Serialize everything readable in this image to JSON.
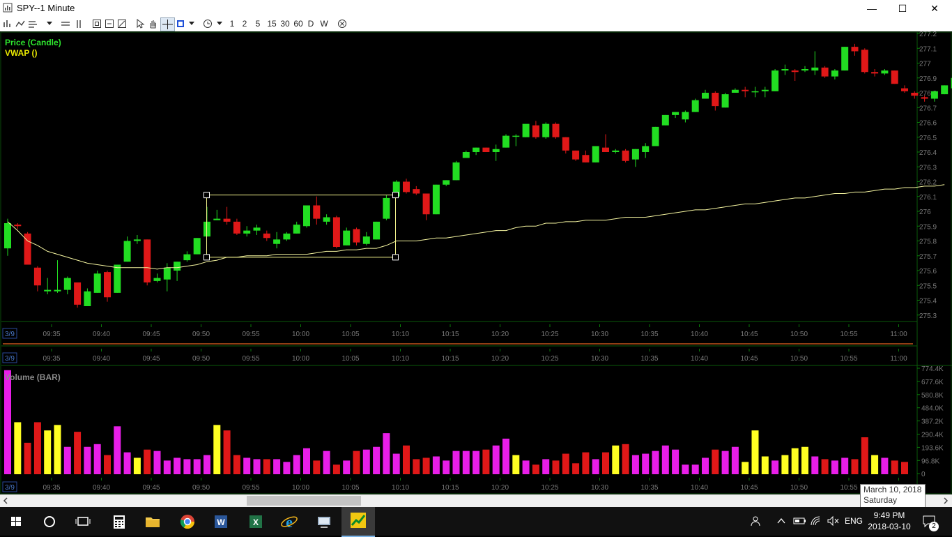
{
  "window": {
    "title": "SPY--1 Minute",
    "min_label": "—",
    "max_label": "☐",
    "close_label": "✕"
  },
  "toolbar": {
    "periods": [
      "1",
      "2",
      "5",
      "15",
      "30",
      "60",
      "D",
      "W"
    ]
  },
  "legend": {
    "price": "Price (Candle)",
    "vwap": "VWAP ()",
    "volume": "Volume (BAR)"
  },
  "tooltip": {
    "line1": "March 10, 2018",
    "line2": "Saturday"
  },
  "taskbar": {
    "time": "9:49 PM",
    "date": "2018-03-10",
    "lang": "ENG",
    "notifications": "2"
  },
  "chart_data": {
    "type": "candlestick",
    "date_label": "3/9",
    "x_ticks": [
      "09:35",
      "09:40",
      "09:45",
      "09:50",
      "09:55",
      "10:00",
      "10:05",
      "10:10",
      "10:15",
      "10:20",
      "10:25",
      "10:30",
      "10:35",
      "10:40",
      "10:45",
      "10:50",
      "10:55",
      "11:00"
    ],
    "price_ticks": [
      277.2,
      277.1,
      277,
      276.9,
      276.8,
      276.7,
      276.6,
      276.5,
      276.4,
      276.3,
      276.2,
      276.1,
      276,
      275.9,
      275.8,
      275.7,
      275.6,
      275.5,
      275.4,
      275.3
    ],
    "price_tick_labels": [
      "277.2",
      "277.1",
      "277",
      "276.9",
      "276.8",
      "276.7",
      "276.6",
      "276.5",
      "276.4",
      "276.3",
      "276.2",
      "276.1",
      "276",
      "275.9",
      "275.8",
      "275.7",
      "275.6",
      "275.5",
      "275.4",
      "275.3"
    ],
    "ylim": [
      275.28,
      277.2
    ],
    "volume_ticks": [
      "774.4K",
      "677.6K",
      "580.8K",
      "484.0K",
      "387.2K",
      "290.4K",
      "193.6K",
      "96.8K",
      "0"
    ],
    "volume_ylim": [
      0,
      774400
    ],
    "colors": {
      "up": "#22dd22",
      "down": "#e01818",
      "vwap": "#f5f5a0",
      "vol_up": "#e81ee8",
      "vol_down": "#e01818",
      "vol_flat": "#ffff22"
    },
    "candles": [
      {
        "o": 275.75,
        "h": 275.95,
        "l": 275.7,
        "c": 275.92
      },
      {
        "o": 275.91,
        "h": 275.92,
        "l": 275.88,
        "c": 275.9
      },
      {
        "o": 275.85,
        "h": 275.86,
        "l": 275.64,
        "c": 275.64
      },
      {
        "o": 275.62,
        "h": 275.63,
        "l": 275.46,
        "c": 275.5
      },
      {
        "o": 275.46,
        "h": 275.55,
        "l": 275.44,
        "c": 275.47
      },
      {
        "o": 275.46,
        "h": 275.67,
        "l": 275.45,
        "c": 275.47
      },
      {
        "o": 275.47,
        "h": 275.56,
        "l": 275.44,
        "c": 275.55
      },
      {
        "o": 275.52,
        "h": 275.52,
        "l": 275.35,
        "c": 275.37
      },
      {
        "o": 275.36,
        "h": 275.48,
        "l": 275.36,
        "c": 275.46
      },
      {
        "o": 275.45,
        "h": 275.6,
        "l": 275.45,
        "c": 275.58
      },
      {
        "o": 275.59,
        "h": 275.6,
        "l": 275.39,
        "c": 275.42
      },
      {
        "o": 275.45,
        "h": 275.64,
        "l": 275.45,
        "c": 275.64
      },
      {
        "o": 275.66,
        "h": 275.83,
        "l": 275.66,
        "c": 275.8
      },
      {
        "o": 275.8,
        "h": 275.84,
        "l": 275.78,
        "c": 275.81
      },
      {
        "o": 275.81,
        "h": 275.81,
        "l": 275.5,
        "c": 275.52
      },
      {
        "o": 275.53,
        "h": 275.58,
        "l": 275.52,
        "c": 275.55
      },
      {
        "o": 275.54,
        "h": 275.65,
        "l": 275.46,
        "c": 275.62
      },
      {
        "o": 275.6,
        "h": 275.66,
        "l": 275.53,
        "c": 275.66
      },
      {
        "o": 275.67,
        "h": 275.73,
        "l": 275.66,
        "c": 275.71
      },
      {
        "o": 275.71,
        "h": 275.82,
        "l": 275.71,
        "c": 275.82
      },
      {
        "o": 275.83,
        "h": 276.03,
        "l": 275.83,
        "c": 275.93
      },
      {
        "o": 275.94,
        "h": 276.01,
        "l": 275.94,
        "c": 275.95
      },
      {
        "o": 275.95,
        "h": 276.03,
        "l": 275.91,
        "c": 275.93
      },
      {
        "o": 275.93,
        "h": 275.95,
        "l": 275.84,
        "c": 275.85
      },
      {
        "o": 275.85,
        "h": 275.9,
        "l": 275.83,
        "c": 275.87
      },
      {
        "o": 275.87,
        "h": 275.91,
        "l": 275.84,
        "c": 275.89
      },
      {
        "o": 275.85,
        "h": 275.87,
        "l": 275.8,
        "c": 275.82
      },
      {
        "o": 275.78,
        "h": 275.86,
        "l": 275.75,
        "c": 275.81
      },
      {
        "o": 275.81,
        "h": 275.86,
        "l": 275.8,
        "c": 275.85
      },
      {
        "o": 275.85,
        "h": 275.93,
        "l": 275.85,
        "c": 275.91
      },
      {
        "o": 275.9,
        "h": 276.04,
        "l": 275.89,
        "c": 276.04
      },
      {
        "o": 276.04,
        "h": 276.1,
        "l": 275.91,
        "c": 275.95
      },
      {
        "o": 275.93,
        "h": 275.98,
        "l": 275.91,
        "c": 275.96
      },
      {
        "o": 275.96,
        "h": 275.97,
        "l": 275.75,
        "c": 275.76
      },
      {
        "o": 275.77,
        "h": 275.89,
        "l": 275.77,
        "c": 275.87
      },
      {
        "o": 275.88,
        "h": 275.89,
        "l": 275.77,
        "c": 275.79
      },
      {
        "o": 275.78,
        "h": 275.86,
        "l": 275.77,
        "c": 275.83
      },
      {
        "o": 275.81,
        "h": 275.93,
        "l": 275.81,
        "c": 275.93
      },
      {
        "o": 275.95,
        "h": 276.11,
        "l": 275.94,
        "c": 276.09
      },
      {
        "o": 276.1,
        "h": 276.21,
        "l": 276.09,
        "c": 276.2
      },
      {
        "o": 276.2,
        "h": 276.22,
        "l": 276.12,
        "c": 276.13
      },
      {
        "o": 276.15,
        "h": 276.17,
        "l": 276.11,
        "c": 276.12
      },
      {
        "o": 276.12,
        "h": 276.12,
        "l": 275.94,
        "c": 275.98
      },
      {
        "o": 275.98,
        "h": 276.18,
        "l": 275.98,
        "c": 276.18
      },
      {
        "o": 276.18,
        "h": 276.21,
        "l": 276.17,
        "c": 276.21
      },
      {
        "o": 276.21,
        "h": 276.34,
        "l": 276.21,
        "c": 276.33
      },
      {
        "o": 276.36,
        "h": 276.41,
        "l": 276.36,
        "c": 276.4
      },
      {
        "o": 276.4,
        "h": 276.43,
        "l": 276.38,
        "c": 276.43
      },
      {
        "o": 276.43,
        "h": 276.43,
        "l": 276.4,
        "c": 276.4
      },
      {
        "o": 276.4,
        "h": 276.45,
        "l": 276.34,
        "c": 276.42
      },
      {
        "o": 276.43,
        "h": 276.52,
        "l": 276.43,
        "c": 276.51
      },
      {
        "o": 276.51,
        "h": 276.52,
        "l": 276.44,
        "c": 276.51
      },
      {
        "o": 276.5,
        "h": 276.56,
        "l": 276.5,
        "c": 276.59
      },
      {
        "o": 276.58,
        "h": 276.61,
        "l": 276.49,
        "c": 276.5
      },
      {
        "o": 276.5,
        "h": 276.6,
        "l": 276.49,
        "c": 276.59
      },
      {
        "o": 276.59,
        "h": 276.6,
        "l": 276.49,
        "c": 276.5
      },
      {
        "o": 276.5,
        "h": 276.5,
        "l": 276.39,
        "c": 276.41
      },
      {
        "o": 276.41,
        "h": 276.41,
        "l": 276.34,
        "c": 276.35
      },
      {
        "o": 276.38,
        "h": 276.41,
        "l": 276.33,
        "c": 276.33
      },
      {
        "o": 276.33,
        "h": 276.44,
        "l": 276.33,
        "c": 276.44
      },
      {
        "o": 276.43,
        "h": 276.52,
        "l": 276.4,
        "c": 276.4
      },
      {
        "o": 276.4,
        "h": 276.42,
        "l": 276.39,
        "c": 276.41
      },
      {
        "o": 276.41,
        "h": 276.42,
        "l": 276.33,
        "c": 276.34
      },
      {
        "o": 276.35,
        "h": 276.42,
        "l": 276.3,
        "c": 276.42
      },
      {
        "o": 276.4,
        "h": 276.46,
        "l": 276.36,
        "c": 276.44
      },
      {
        "o": 276.44,
        "h": 276.57,
        "l": 276.44,
        "c": 276.57
      },
      {
        "o": 276.58,
        "h": 276.65,
        "l": 276.58,
        "c": 276.65
      },
      {
        "o": 276.65,
        "h": 276.67,
        "l": 276.63,
        "c": 276.67
      },
      {
        "o": 276.62,
        "h": 276.68,
        "l": 276.6,
        "c": 276.67
      },
      {
        "o": 276.67,
        "h": 276.76,
        "l": 276.67,
        "c": 276.75
      },
      {
        "o": 276.76,
        "h": 276.82,
        "l": 276.76,
        "c": 276.8
      },
      {
        "o": 276.8,
        "h": 276.81,
        "l": 276.68,
        "c": 276.71
      },
      {
        "o": 276.7,
        "h": 276.8,
        "l": 276.7,
        "c": 276.79
      },
      {
        "o": 276.8,
        "h": 276.83,
        "l": 276.8,
        "c": 276.82
      },
      {
        "o": 276.82,
        "h": 276.84,
        "l": 276.77,
        "c": 276.81
      },
      {
        "o": 276.81,
        "h": 276.84,
        "l": 276.77,
        "c": 276.81
      },
      {
        "o": 276.81,
        "h": 276.84,
        "l": 276.77,
        "c": 276.82
      },
      {
        "o": 276.81,
        "h": 276.96,
        "l": 276.81,
        "c": 276.95
      },
      {
        "o": 276.95,
        "h": 276.99,
        "l": 276.92,
        "c": 276.96
      },
      {
        "o": 276.95,
        "h": 276.96,
        "l": 276.88,
        "c": 276.94
      },
      {
        "o": 276.95,
        "h": 276.98,
        "l": 276.94,
        "c": 276.96
      },
      {
        "o": 276.95,
        "h": 277.08,
        "l": 276.92,
        "c": 276.97
      },
      {
        "o": 276.97,
        "h": 276.98,
        "l": 276.9,
        "c": 276.91
      },
      {
        "o": 276.91,
        "h": 276.96,
        "l": 276.89,
        "c": 276.95
      },
      {
        "o": 276.95,
        "h": 277.11,
        "l": 276.95,
        "c": 277.11
      },
      {
        "o": 277.11,
        "h": 277.13,
        "l": 277.05,
        "c": 277.08
      },
      {
        "o": 277.09,
        "h": 277.1,
        "l": 276.93,
        "c": 276.94
      },
      {
        "o": 276.94,
        "h": 276.96,
        "l": 276.91,
        "c": 276.93
      },
      {
        "o": 276.93,
        "h": 276.96,
        "l": 276.92,
        "c": 276.95
      },
      {
        "o": 276.95,
        "h": 276.95,
        "l": 276.86,
        "c": 276.86
      },
      {
        "o": 276.83,
        "h": 276.85,
        "l": 276.8,
        "c": 276.81
      },
      {
        "o": 276.8,
        "h": 276.81,
        "l": 276.76,
        "c": 276.78
      },
      {
        "o": 276.77,
        "h": 276.78,
        "l": 276.74,
        "c": 276.76
      },
      {
        "o": 276.76,
        "h": 276.8,
        "l": 276.74,
        "c": 276.81
      },
      {
        "o": 276.79,
        "h": 276.85,
        "l": 276.79,
        "c": 276.85
      },
      {
        "o": 276.83,
        "h": 276.91,
        "l": 276.83,
        "c": 276.9
      }
    ],
    "vwap": [
      275.93,
      275.87,
      275.8,
      275.77,
      275.73,
      275.71,
      275.69,
      275.67,
      275.65,
      275.64,
      275.63,
      275.62,
      275.62,
      275.62,
      275.62,
      275.61,
      275.62,
      275.62,
      275.63,
      275.64,
      275.66,
      275.67,
      275.69,
      275.69,
      275.7,
      275.7,
      275.7,
      275.71,
      275.71,
      275.71,
      275.71,
      275.72,
      275.73,
      275.73,
      275.74,
      275.74,
      275.75,
      275.75,
      275.77,
      275.8,
      275.8,
      275.8,
      275.81,
      275.82,
      275.82,
      275.83,
      275.84,
      275.85,
      275.86,
      275.87,
      275.87,
      275.89,
      275.9,
      275.9,
      275.92,
      275.92,
      275.93,
      275.93,
      275.94,
      275.94,
      275.94,
      275.95,
      275.96,
      275.96,
      275.96,
      275.97,
      275.98,
      275.99,
      276.0,
      276.01,
      276.01,
      276.02,
      276.03,
      276.04,
      276.05,
      276.05,
      276.06,
      276.07,
      276.08,
      276.09,
      276.09,
      276.1,
      276.11,
      276.12,
      276.12,
      276.13,
      276.13,
      276.14,
      276.15,
      276.15,
      276.16,
      276.16,
      276.17,
      276.17,
      276.18
    ],
    "volume": [
      760000,
      380000,
      230000,
      380000,
      320000,
      360000,
      200000,
      310000,
      200000,
      220000,
      140000,
      350000,
      160000,
      120000,
      180000,
      170000,
      100000,
      120000,
      110000,
      110000,
      140000,
      360000,
      320000,
      140000,
      120000,
      110000,
      110000,
      110000,
      90000,
      140000,
      190000,
      100000,
      170000,
      70000,
      100000,
      170000,
      180000,
      200000,
      300000,
      150000,
      210000,
      110000,
      120000,
      130000,
      100000,
      170000,
      170000,
      170000,
      180000,
      210000,
      260000,
      140000,
      100000,
      70000,
      110000,
      100000,
      150000,
      80000,
      160000,
      110000,
      160000,
      210000,
      220000,
      140000,
      150000,
      170000,
      210000,
      180000,
      70000,
      70000,
      120000,
      180000,
      170000,
      200000,
      90000,
      320000,
      130000,
      100000,
      140000,
      190000,
      200000,
      130000,
      110000,
      100000,
      120000,
      110000,
      270000,
      140000,
      120000,
      100000,
      90000
    ],
    "selection_box": {
      "x_start_label": "09:50",
      "x_end_label": "10:10",
      "y_top": 276.11,
      "y_bottom": 275.69
    }
  }
}
